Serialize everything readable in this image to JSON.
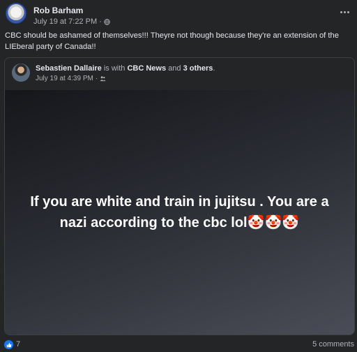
{
  "post": {
    "author": "Rob Barham",
    "timestamp": "July 19 at 7:22 PM",
    "separator": "·",
    "privacy_icon": "globe-icon",
    "more_icon": "more-options-icon",
    "text": "CBC should be ashamed of themselves!!! Theyre not though because they're an extension of the LIEberal party of Canada!!"
  },
  "shared_post": {
    "author": "Sebastien Dallaire",
    "is_with": "is with",
    "tagged_page": "CBC News",
    "and_text": "and",
    "others": "3 others",
    "period": ".",
    "timestamp": "July 19 at 4:39 PM",
    "separator": "·",
    "privacy_icon": "friends-icon",
    "content_text": "If you are white and train in jujitsu . You are a nazi according to the cbc lol🤡🤡🤡"
  },
  "footer": {
    "like_icon": "thumbs-up-icon",
    "reaction_count": "7",
    "comments": "5 comments"
  },
  "colors": {
    "background": "#242526",
    "text_primary": "#e4e6eb",
    "text_secondary": "#b0b3b8",
    "like_blue": "#1877f2"
  }
}
